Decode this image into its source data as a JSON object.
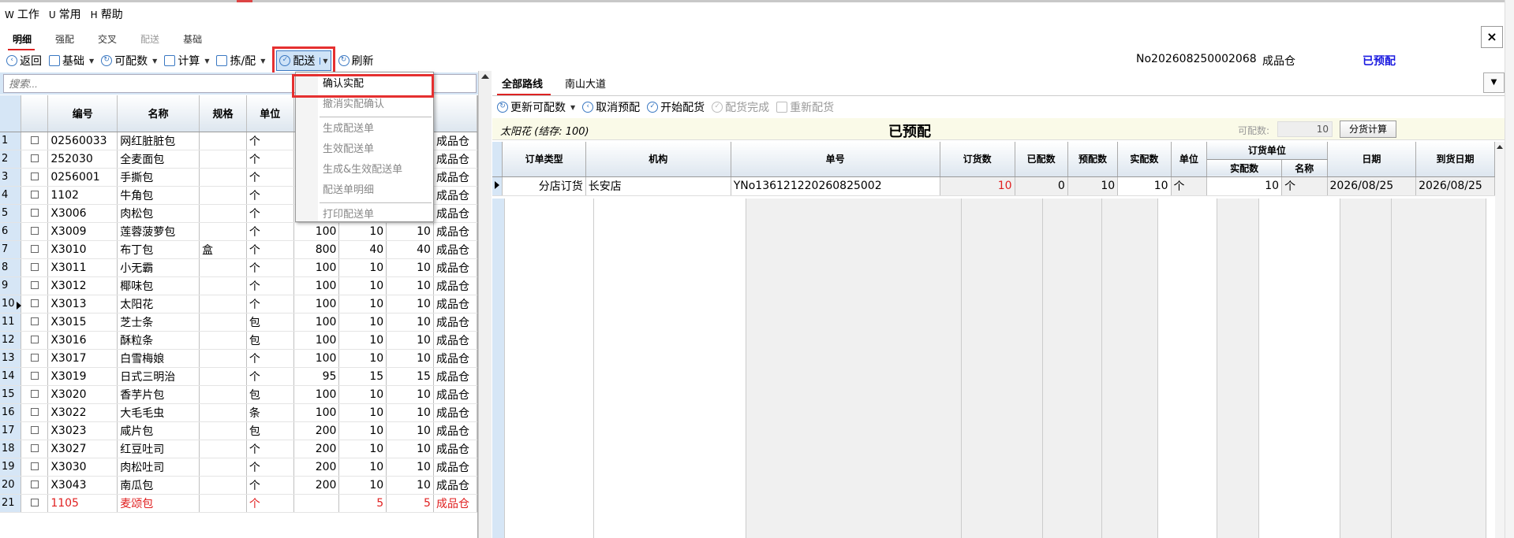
{
  "menu": [
    {
      "key": "W",
      "label": "工作"
    },
    {
      "key": "U",
      "label": "常用"
    },
    {
      "key": "H",
      "label": "帮助"
    }
  ],
  "tabs": [
    "明细",
    "强配",
    "交叉",
    "配送",
    "基础"
  ],
  "close_label": "×",
  "toolbar": {
    "back": "返回",
    "basic": "基础",
    "avail": "可配数",
    "calc": "计算",
    "pick": "拣/配",
    "deliver": "配送",
    "refresh": "刷新"
  },
  "doc_no": "No202608250002068",
  "warehouse": "成品仓",
  "status": "已预配",
  "search": {
    "placeholder": "搜索..."
  },
  "left_headers": [
    "编号",
    "名称",
    "规格",
    "单位"
  ],
  "left_rows": [
    {
      "n": "1",
      "code": "02560033",
      "name": "网红脏脏包",
      "spec": "",
      "unit": "个",
      "a": "",
      "b": "",
      "c": "",
      "wh": "成品仓"
    },
    {
      "n": "2",
      "code": "252030",
      "name": "全麦面包",
      "spec": "",
      "unit": "个",
      "a": "",
      "b": "",
      "c": "",
      "wh": "成品仓"
    },
    {
      "n": "3",
      "code": "0256001",
      "name": "手撕包",
      "spec": "",
      "unit": "个",
      "a": "",
      "b": "",
      "c": "",
      "wh": "成品仓"
    },
    {
      "n": "4",
      "code": "1102",
      "name": "牛角包",
      "spec": "",
      "unit": "个",
      "a": "",
      "b": "",
      "c": "",
      "wh": "成品仓"
    },
    {
      "n": "5",
      "code": "X3006",
      "name": "肉松包",
      "spec": "",
      "unit": "个",
      "a": "",
      "b": "",
      "c": "",
      "wh": "成品仓"
    },
    {
      "n": "6",
      "code": "X3009",
      "name": "莲蓉菠萝包",
      "spec": "",
      "unit": "个",
      "a": "100",
      "b": "10",
      "c": "10",
      "wh": "成品仓"
    },
    {
      "n": "7",
      "code": "X3010",
      "name": "布丁包",
      "spec": "盒",
      "unit": "个",
      "a": "800",
      "b": "40",
      "c": "40",
      "wh": "成品仓"
    },
    {
      "n": "8",
      "code": "X3011",
      "name": "小无霸",
      "spec": "",
      "unit": "个",
      "a": "100",
      "b": "10",
      "c": "10",
      "wh": "成品仓"
    },
    {
      "n": "9",
      "code": "X3012",
      "name": "椰味包",
      "spec": "",
      "unit": "个",
      "a": "100",
      "b": "10",
      "c": "10",
      "wh": "成品仓"
    },
    {
      "n": "10",
      "code": "X3013",
      "name": "太阳花",
      "spec": "",
      "unit": "个",
      "a": "100",
      "b": "10",
      "c": "10",
      "wh": "成品仓"
    },
    {
      "n": "11",
      "code": "X3015",
      "name": "芝士条",
      "spec": "",
      "unit": "包",
      "a": "100",
      "b": "10",
      "c": "10",
      "wh": "成品仓"
    },
    {
      "n": "12",
      "code": "X3016",
      "name": "酥粒条",
      "spec": "",
      "unit": "包",
      "a": "100",
      "b": "10",
      "c": "10",
      "wh": "成品仓"
    },
    {
      "n": "13",
      "code": "X3017",
      "name": "白雪梅娘",
      "spec": "",
      "unit": "个",
      "a": "100",
      "b": "10",
      "c": "10",
      "wh": "成品仓"
    },
    {
      "n": "14",
      "code": "X3019",
      "name": "日式三明治",
      "spec": "",
      "unit": "个",
      "a": "95",
      "b": "15",
      "c": "15",
      "wh": "成品仓"
    },
    {
      "n": "15",
      "code": "X3020",
      "name": "香芋片包",
      "spec": "",
      "unit": "包",
      "a": "100",
      "b": "10",
      "c": "10",
      "wh": "成品仓"
    },
    {
      "n": "16",
      "code": "X3022",
      "name": "大毛毛虫",
      "spec": "",
      "unit": "条",
      "a": "100",
      "b": "10",
      "c": "10",
      "wh": "成品仓"
    },
    {
      "n": "17",
      "code": "X3023",
      "name": "咸片包",
      "spec": "",
      "unit": "包",
      "a": "200",
      "b": "10",
      "c": "10",
      "wh": "成品仓"
    },
    {
      "n": "18",
      "code": "X3027",
      "name": "红豆吐司",
      "spec": "",
      "unit": "个",
      "a": "200",
      "b": "10",
      "c": "10",
      "wh": "成品仓"
    },
    {
      "n": "19",
      "code": "X3030",
      "name": "肉松吐司",
      "spec": "",
      "unit": "个",
      "a": "200",
      "b": "10",
      "c": "10",
      "wh": "成品仓"
    },
    {
      "n": "20",
      "code": "X3043",
      "name": "南瓜包",
      "spec": "",
      "unit": "个",
      "a": "200",
      "b": "10",
      "c": "10",
      "wh": "成品仓"
    },
    {
      "n": "21",
      "code": "1105",
      "name": "麦颂包",
      "spec": "",
      "unit": "个",
      "a": "",
      "b": "5",
      "c": "5",
      "wh": "成品仓"
    }
  ],
  "dropdown": [
    {
      "label": "确认实配",
      "enabled": true
    },
    {
      "label": "撤消实配确认",
      "enabled": false
    },
    {
      "sep": true
    },
    {
      "label": "生成配送单",
      "enabled": false
    },
    {
      "label": "生效配送单",
      "enabled": false
    },
    {
      "label": "生成&生效配送单",
      "enabled": false
    },
    {
      "label": "配送单明细",
      "enabled": false
    },
    {
      "sep": true
    },
    {
      "label": "打印配送单",
      "enabled": false
    }
  ],
  "right_tabs": [
    "全部路线",
    "南山大道"
  ],
  "right_toolbar": {
    "update": "更新可配数",
    "cancel": "取消预配",
    "start": "开始配货",
    "done": "配货完成",
    "redo": "重新配货"
  },
  "info": {
    "item": "太阳花 (结存: 100)",
    "status": "已预配",
    "avail_label": "可配数:",
    "avail_value": "10",
    "split_btn": "分货计算"
  },
  "right_headers": {
    "type": "订单类型",
    "org": "机构",
    "no": "单号",
    "order": "订货数",
    "done": "已配数",
    "pre": "预配数",
    "real": "实配数",
    "unit": "单位",
    "ounit": "订货单位",
    "ounit_real": "实配数",
    "ounit_name": "名称",
    "date": "日期",
    "arrive": "到货日期"
  },
  "right_rows": [
    {
      "type": "分店订货",
      "org": "长安店",
      "no": "YNo136121220260825002",
      "order": "10",
      "done": "0",
      "pre": "10",
      "real": "10",
      "unit": "个",
      "oreal": "10",
      "oname": "个",
      "date": "2026/08/25",
      "arrive": "2026/08/25"
    }
  ]
}
